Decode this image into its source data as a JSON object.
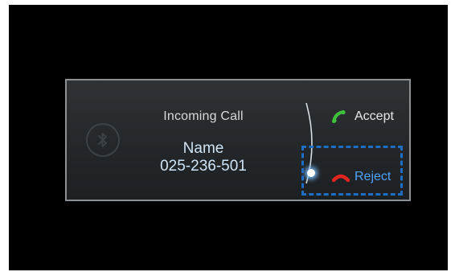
{
  "dialog": {
    "title": "Incoming Call",
    "caller_name": "Name",
    "caller_number": "025-236-501"
  },
  "actions": {
    "accept_label": "Accept",
    "reject_label": "Reject"
  },
  "icons": {
    "bluetooth": "bluetooth-icon",
    "accept": "phone-accept-icon",
    "reject": "phone-reject-icon"
  },
  "colors": {
    "accept_icon": "#3fbf3a",
    "reject_icon": "#e0261f",
    "reject_text": "#4da3ff",
    "highlight_box": "#1e6fc4"
  }
}
